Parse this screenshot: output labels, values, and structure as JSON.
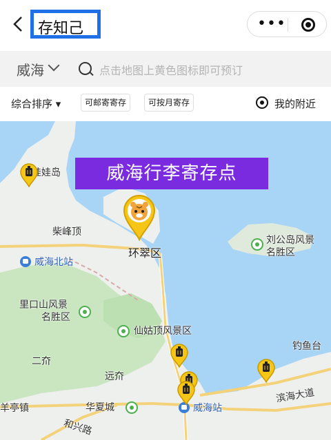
{
  "nav": {
    "back_glyph": "<",
    "title": "存知己",
    "more_glyph": "•••"
  },
  "search": {
    "city": "威海",
    "placeholder": "点击地图上黄色图标即可预订"
  },
  "filters": {
    "sort_label": "综合排序 ▾",
    "chip_mail": "可邮寄寄存",
    "chip_monthly": "可按月寄存",
    "nearby_label": "我的附近"
  },
  "map": {
    "banner": "威海行李寄存点",
    "labels": {
      "wawa_island": "娃娃岛",
      "chaifeng": "柴峰顶",
      "huancui": "环翠区",
      "weihai_north": "威海北站",
      "liugong_line1": "刘公岛风景",
      "liugong_line2": "名胜区",
      "likoushan_line1": "里口山风景",
      "likoushan_line2": "名胜区",
      "xiangu": "仙姑顶风景区",
      "diaoyutai": "钓鱼台",
      "erjie": "二夼",
      "yuanjie": "远夼",
      "huaxia": "华夏城",
      "yangting": "羊亭镇",
      "weihai_station": "威海站",
      "binhai": "滨海大道",
      "hexing": "和兴路"
    },
    "colors": {
      "sea": "#a8d4f5",
      "land": "#eef0ee",
      "green": "#c9e6c0",
      "marker": "#f5c518",
      "banner": "#7a2be0"
    },
    "marker_icon": "luggage-marker-icon",
    "tiger_icon": "tiger-pin-icon"
  }
}
